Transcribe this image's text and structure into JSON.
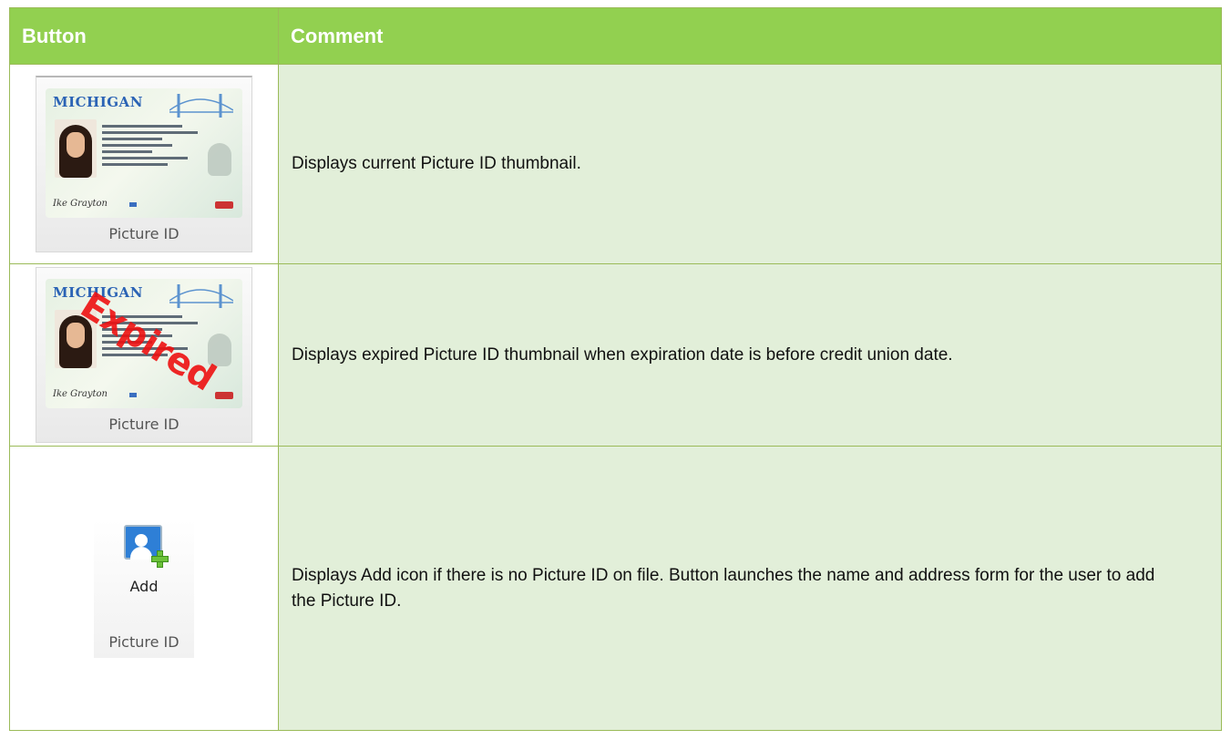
{
  "table": {
    "headers": {
      "button": "Button",
      "comment": "Comment"
    },
    "rows": [
      {
        "button": {
          "label": "Picture ID",
          "card_state": "MICHIGAN",
          "signature": "Ike Grayton"
        },
        "comment": "Displays current Picture ID thumbnail."
      },
      {
        "button": {
          "label": "Picture ID",
          "card_state": "MICHIGAN",
          "signature": "Ike Grayton",
          "overlay": "Expired"
        },
        "comment": "Displays expired Picture ID thumbnail when expiration date is before credit union date."
      },
      {
        "button": {
          "icon_label": "Add",
          "label": "Picture ID"
        },
        "comment": "Displays Add icon if there is no Picture ID on file.  Button launches the name and address form for the user to add the Picture ID."
      }
    ]
  },
  "colors": {
    "header_bg": "#92d050",
    "row_bg": "#e2efd9",
    "border": "#9bbb59",
    "expired_text": "#ee1111"
  }
}
